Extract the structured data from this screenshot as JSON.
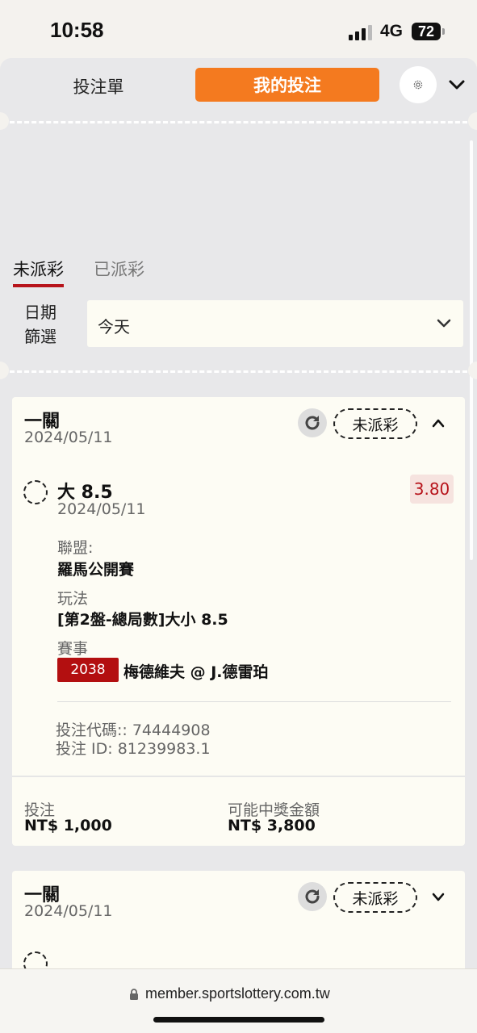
{
  "status": {
    "time": "10:58",
    "network": "4G",
    "battery": "72"
  },
  "header": {
    "tab_betslip": "投注單",
    "tab_mybets": "我的投注"
  },
  "filters": {
    "tab_unsettled": "未派彩",
    "tab_settled": "已派彩",
    "date_label": "日期篩選",
    "date_value": "今天"
  },
  "bets": [
    {
      "type": "一關",
      "date": "2024/05/11",
      "status": "未派彩",
      "selection": "大 8.5",
      "selection_date": "2024/05/11",
      "odds": "3.80",
      "league_label": "聯盟:",
      "league": "羅馬公開賽",
      "market_label": "玩法",
      "market": "[第2盤-總局數]大小 8.5",
      "event_label": "賽事",
      "event_code": "2038",
      "event_name": "梅德維夫 @ J.德雷珀",
      "bet_code": "投注代碼:: 74444908",
      "bet_id": "投注 ID: 81239983.1",
      "stake_label": "投注",
      "stake": "NT$ 1,000",
      "payout_label": "可能中獎金額",
      "payout": "NT$ 3,800"
    },
    {
      "type": "一關",
      "date": "2024/05/11",
      "status": "未派彩"
    }
  ],
  "browser": {
    "url": "member.sportslottery.com.tw"
  },
  "colors": {
    "accent": "#f47a1f",
    "brand_red": "#b7141b",
    "badge_red": "#b30f10"
  }
}
